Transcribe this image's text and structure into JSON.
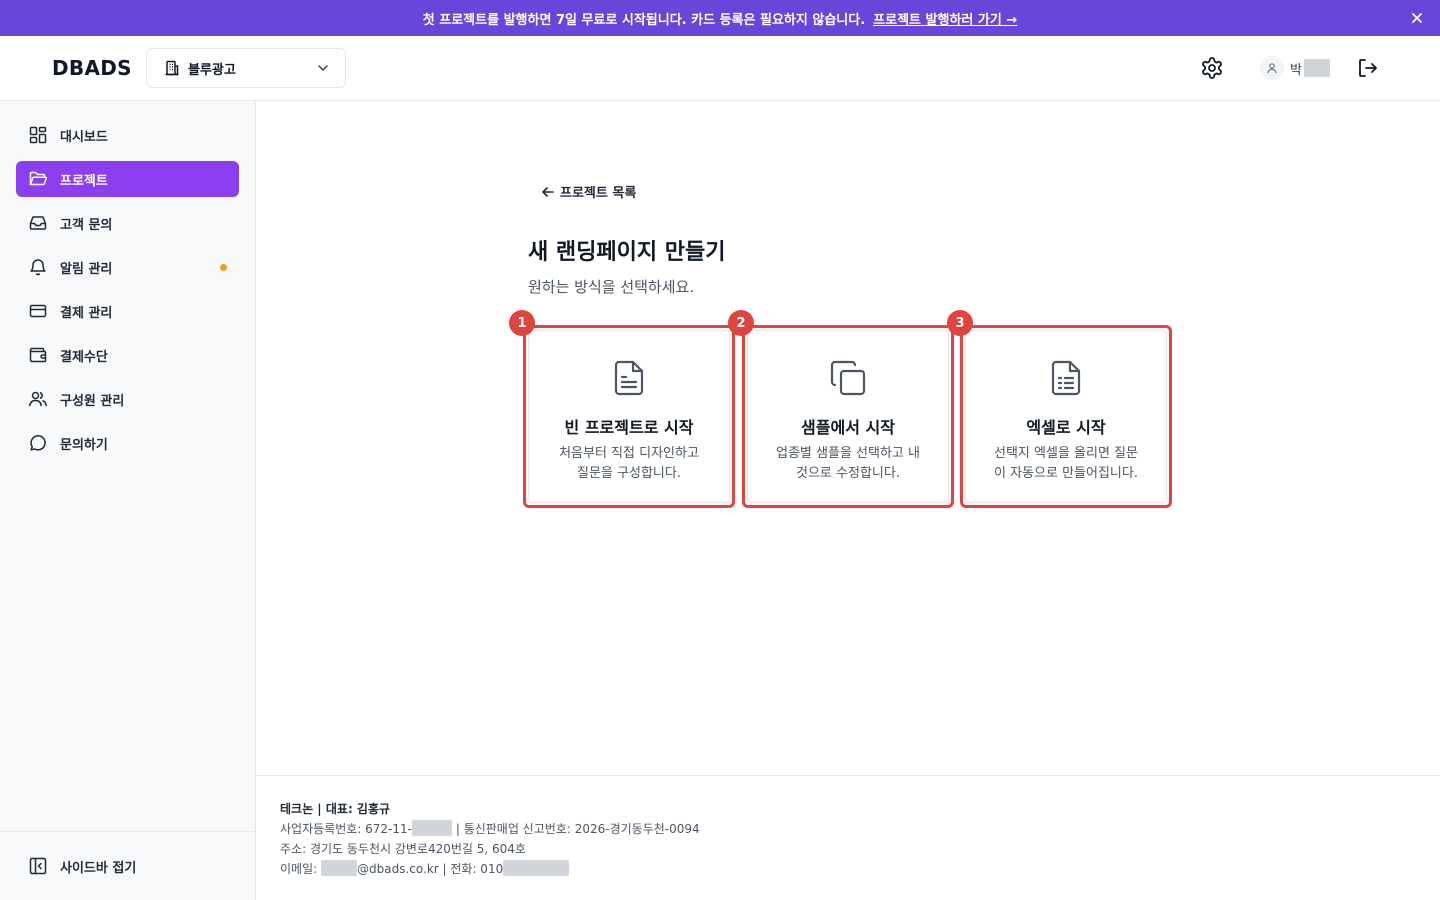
{
  "banner": {
    "text": "첫 프로젝트를 발행하면 7일 무료로 시작됩니다. 카드 등록은 필요하지 않습니다.",
    "link": "프로젝트 발행하러 가기 →",
    "close_icon": "close-icon",
    "color": "#6746d9"
  },
  "header": {
    "logo": "DBADS",
    "org_select": {
      "value": "블루광고",
      "icon": "building-icon"
    },
    "user": {
      "name": "박"
    }
  },
  "sidebar": {
    "accent": "#8b3ff0",
    "items": [
      {
        "label": "대시보드",
        "icon": "dashboard-icon"
      },
      {
        "label": "프로젝트",
        "icon": "folder-icon",
        "active": true
      },
      {
        "label": "고객 문의",
        "icon": "inbox-icon"
      },
      {
        "label": "알림 관리",
        "icon": "bell-icon",
        "dot": true
      },
      {
        "label": "결제 관리",
        "icon": "credit-card-icon"
      },
      {
        "label": "결제수단",
        "icon": "wallet-icon"
      },
      {
        "label": "구성원 관리",
        "icon": "users-icon"
      },
      {
        "label": "문의하기",
        "icon": "chat-icon"
      }
    ],
    "collapse_label": "사이드바 접기"
  },
  "main": {
    "back_label": "프로젝트 목록",
    "title": "새 랜딩페이지 만들기",
    "subtitle": "원하는 방식을 선택하세요.",
    "highlight_color": "#e0443e",
    "cards": [
      {
        "badge": "1",
        "title": "빈 프로젝트로 시작",
        "desc": "처음부터 직접 디자인하고 질문을 구성합니다.",
        "icon": "document-icon"
      },
      {
        "badge": "2",
        "title": "샘플에서 시작",
        "desc": "업종별 샘플을 선택하고 내 것으로 수정합니다.",
        "icon": "copy-icon"
      },
      {
        "badge": "3",
        "title": "엑셀로 시작",
        "desc": "선택지 엑셀을 올리면 질문이 자동으로 만들어집니다.",
        "icon": "spreadsheet-icon"
      }
    ]
  },
  "footer": {
    "line1": "테크논 | 대표: 김홍규",
    "line2_a": "사업자등록번호: 672-11-",
    "line2_b": "| 통신판매업 신고번호: 2026-경기동두천-0094",
    "line3": "주소: 경기도 동두천시 강변로420번길 5, 604호",
    "line4_a": "이메일:",
    "line4_b": "@dbads.co.kr | 전화: 010"
  }
}
